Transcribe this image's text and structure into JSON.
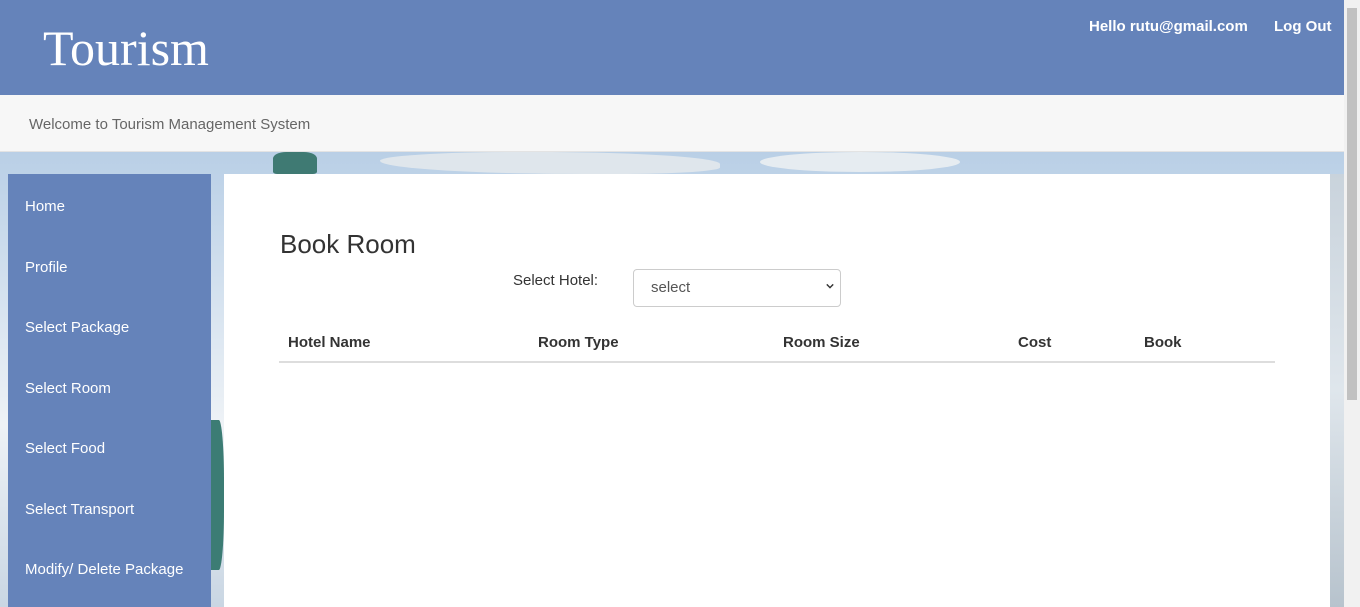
{
  "header": {
    "brand": "Tourism",
    "greeting": "Hello rutu@gmail.com",
    "logout_label": "Log Out"
  },
  "welcome": {
    "text": "Welcome to Tourism Management System"
  },
  "sidebar": {
    "items": [
      {
        "label": "Home"
      },
      {
        "label": "Profile"
      },
      {
        "label": "Select Package"
      },
      {
        "label": "Select Room"
      },
      {
        "label": "Select Food"
      },
      {
        "label": "Select Transport"
      },
      {
        "label": "Modify/ Delete Package"
      }
    ]
  },
  "main": {
    "title": "Book Room",
    "select_label": "Select Hotel:",
    "select_value": "select",
    "columns": [
      "Hotel Name",
      "Room Type",
      "Room Size",
      "Cost",
      "Book"
    ]
  },
  "colors": {
    "header_bg": "#6583ba",
    "sidebar_bg": "#6583ba",
    "welcome_bg": "#f7f7f7"
  }
}
